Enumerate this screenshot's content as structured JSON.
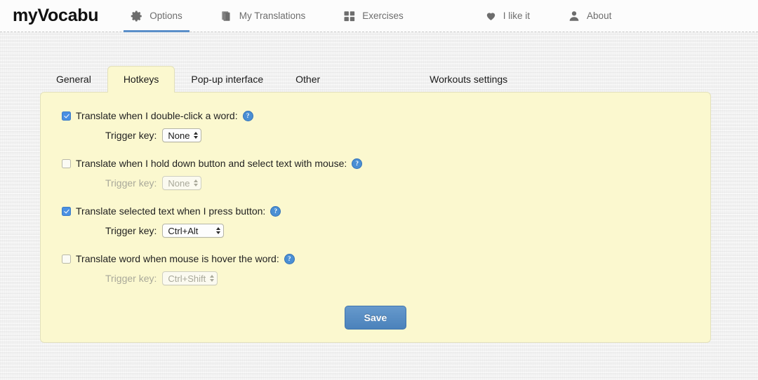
{
  "navbar": {
    "brand": "myVocabu",
    "items": [
      {
        "label": "Options",
        "icon": "gear-icon",
        "active": true
      },
      {
        "label": "My Translations",
        "icon": "books-icon",
        "active": false
      },
      {
        "label": "Exercises",
        "icon": "grid-icon",
        "active": false
      },
      {
        "label": "I like it",
        "icon": "heart-icon",
        "active": false
      },
      {
        "label": "About",
        "icon": "user-icon",
        "active": false
      }
    ]
  },
  "tabs": [
    {
      "label": "General",
      "active": false
    },
    {
      "label": "Hotkeys",
      "active": true
    },
    {
      "label": "Pop-up interface",
      "active": false
    },
    {
      "label": "Other",
      "active": false
    },
    {
      "label": "Workouts settings",
      "active": false
    }
  ],
  "panel": {
    "trigger_label": "Trigger key:",
    "help_glyph": "?",
    "options": [
      {
        "label": "Translate when I double-click a word:",
        "checked": true,
        "trigger_value": "None",
        "trigger_enabled": true,
        "select_wide": false
      },
      {
        "label": "Translate when I hold down button and select text with mouse:",
        "checked": false,
        "trigger_value": "None",
        "trigger_enabled": false,
        "select_wide": false
      },
      {
        "label": "Translate selected text when I press button:",
        "checked": true,
        "trigger_value": "Ctrl+Alt",
        "trigger_enabled": true,
        "select_wide": true
      },
      {
        "label": "Translate word when mouse is hover the word:",
        "checked": false,
        "trigger_value": "Ctrl+Shift",
        "trigger_enabled": false,
        "select_wide": false
      }
    ],
    "save_label": "Save"
  },
  "colors": {
    "accent": "#4b82bb",
    "panel_bg": "#fbf8cf",
    "nav_active": "#5b8fc9"
  }
}
